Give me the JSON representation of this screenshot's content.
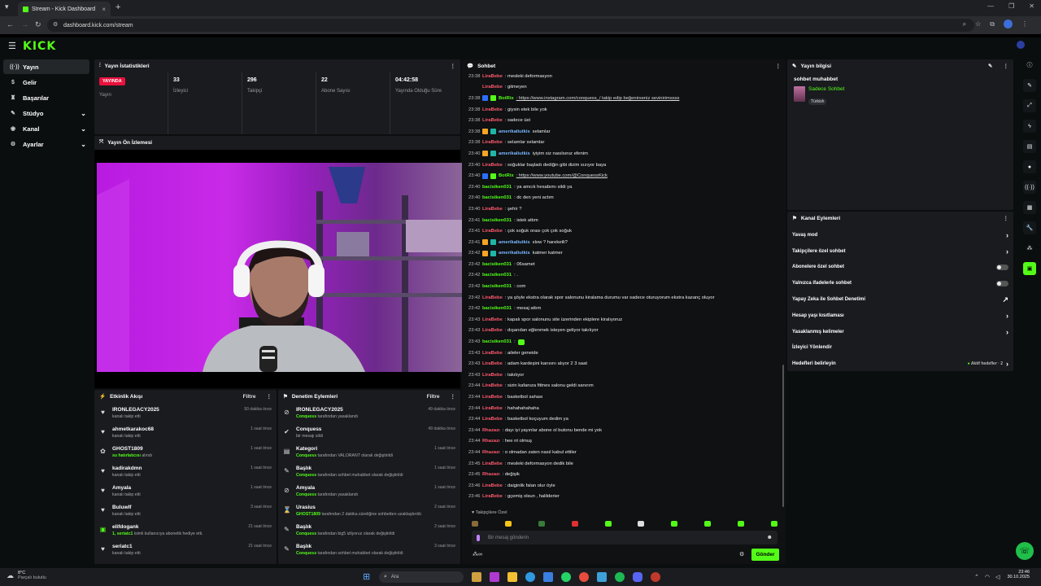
{
  "browser": {
    "tab_title": "Stream - Kick Dashboard",
    "url": "dashboard.kick.com/stream"
  },
  "logo": "KICK",
  "sidebar": {
    "items": [
      {
        "label": "Yayın",
        "icon": "broadcast-icon",
        "active": true
      },
      {
        "label": "Gelir",
        "icon": "money-icon"
      },
      {
        "label": "Başarılar",
        "icon": "trophy-icon"
      },
      {
        "label": "Stüdyo",
        "icon": "studio-icon",
        "expand": true
      },
      {
        "label": "Kanal",
        "icon": "channel-icon",
        "expand": true
      },
      {
        "label": "Ayarlar",
        "icon": "gear-icon",
        "expand": true
      }
    ]
  },
  "stats": {
    "title": "Yayın İstatistikleri",
    "live_badge": "YAYINDA",
    "live_label": "Yayın",
    "items": [
      {
        "value": "33",
        "label": "İzleyici"
      },
      {
        "value": "296",
        "label": "Takipçi"
      },
      {
        "value": "22",
        "label": "Abone Sayısı"
      },
      {
        "value": "04:42:58",
        "label": "Yayında Olduğu Süre"
      }
    ]
  },
  "preview": {
    "title": "Yayın Ön İzlemesi"
  },
  "activity": {
    "title": "Etkinlik Akışı",
    "filter": "Filtre",
    "rows": [
      {
        "icon": "heart-icon",
        "name": "IRONLEGACY2025",
        "desc": "kanalı takip etti",
        "time": "50 dakika önce"
      },
      {
        "icon": "heart-icon",
        "name": "ahmetkarakoc68",
        "desc": "kanalı takip etti",
        "time": "1 saat önce"
      },
      {
        "icon": "gift-icon",
        "name": "GHOST1809",
        "hl": "su hatırlatıcısı",
        "desc": "alındı",
        "time": "1 saat önce"
      },
      {
        "icon": "heart-icon",
        "name": "kadirakdmn",
        "desc": "kanalı takip etti",
        "time": "1 saat önce"
      },
      {
        "icon": "heart-icon",
        "name": "Amyala",
        "desc": "kanalı takip etti",
        "time": "1 saat önce"
      },
      {
        "icon": "heart-icon",
        "name": "Buluwlf",
        "desc": "kanalı takip etti",
        "time": "3 saat önce"
      },
      {
        "icon": "sub-gift-icon",
        "name": "elifdogank",
        "hl": "1, seriatc1",
        "desc": "isimli kullanıcıya abonelik hediye etti.",
        "time": "21 saat önce"
      },
      {
        "icon": "heart-icon",
        "name": "seriatc1",
        "desc": "kanalı takip etti",
        "time": "21 saat önce"
      }
    ]
  },
  "moderation": {
    "title": "Denetim Eylemleri",
    "filter": "Filtre",
    "rows": [
      {
        "icon": "ban-icon",
        "name": "IRONLEGACY2025",
        "hl": "Conquess",
        "desc": "tarafından yasaklandı",
        "time": "49 dakika önce"
      },
      {
        "icon": "check-icon",
        "name": "Conquess",
        "desc": "bir mesajı sildi",
        "time": "49 dakika önce"
      },
      {
        "icon": "category-icon",
        "name": "Kategori",
        "hl": "Conquess",
        "desc": "tarafından VALORANT olarak değiştirildi",
        "time": "1 saat önce"
      },
      {
        "icon": "title-icon",
        "name": "Başlık",
        "hl": "Conquess",
        "desc": "tarafından sohbet muhabbet olarak değiştirildi",
        "time": "1 saat önce"
      },
      {
        "icon": "ban-icon",
        "name": "Amyala",
        "hl": "Conquess",
        "desc": "tarafından yasaklandı",
        "time": "1 saat önce"
      },
      {
        "icon": "hourglass-icon",
        "name": "Urasius",
        "hl": "GHOST1809",
        "desc": "tarafından 2 dakika süreliğine sohbetten uzaklaştırıldı",
        "time": "2 saat önce"
      },
      {
        "icon": "title-icon",
        "name": "Başlık",
        "hl": "Conquess",
        "desc": "tarafından big5 izliyoruz olarak değiştirildi",
        "time": "2 saat önce"
      },
      {
        "icon": "title-icon",
        "name": "Başlık",
        "hl": "Conquess",
        "desc": "tarafından sohbet muhabbet olarak değiştirildi",
        "time": "3 saat önce"
      }
    ]
  },
  "chat": {
    "title": "Sohbet",
    "messages": [
      {
        "t": "23:38",
        "u": "LiraBebe",
        "c": "#ff5a6e",
        "m": ": mesleki deformasyon"
      },
      {
        "t": "",
        "u": "LiraBebe",
        "c": "#ff5a6e",
        "m": ": gitmeyen"
      },
      {
        "t": "23:38",
        "u": "BotRix",
        "c": "#53fc18",
        "m": ": https://www.instagram.com/conquess_/ takip edip beğenirseniz sevinirimssss",
        "badges": [
          "#2b6fff",
          "#53fc18"
        ],
        "link": true
      },
      {
        "t": "23:38",
        "u": "LiraBebe",
        "c": "#ff5a6e",
        "m": ": giysin etek bile yok"
      },
      {
        "t": "23:38",
        "u": "LiraBebe",
        "c": "#ff5a6e",
        "m": ": sadece üst"
      },
      {
        "t": "23:38",
        "u": "amerikaliutkis",
        "c": "#7ab6ff",
        "m": " selamlar",
        "badges": [
          "#f5a623",
          "#1fb6a5"
        ]
      },
      {
        "t": "23:38",
        "u": "LiraBebe",
        "c": "#ff5a6e",
        "m": ": selamlar selamlar"
      },
      {
        "t": "23:40",
        "u": "amerikaliutkis",
        "c": "#7ab6ff",
        "m": " iyiyim siz nasılsınız efenim",
        "badges": [
          "#f5a623",
          "#1fb6a5"
        ]
      },
      {
        "t": "23:40",
        "u": "LiraBebe",
        "c": "#ff5a6e",
        "m": ": soğuklar başladı dediğin gibi dizim sızıyor baya"
      },
      {
        "t": "23:40",
        "u": "BotRix",
        "c": "#53fc18",
        "m": ": https://www.youtube.com/@ConquessKick",
        "badges": [
          "#2b6fff",
          "#53fc18"
        ],
        "link": true
      },
      {
        "t": "23:40",
        "u": "bacisiken031",
        "c": "#53fc18",
        "m": ": ya amcık hesabımı sildi ya"
      },
      {
        "t": "23:40",
        "u": "bacisiken031",
        "c": "#53fc18",
        "m": ": dc den yeni actım"
      },
      {
        "t": "23:40",
        "u": "LiraBebe",
        "c": "#ff5a6e",
        "m": ": şehir ?"
      },
      {
        "t": "23:41",
        "u": "bacisiken031",
        "c": "#53fc18",
        "m": ": istek attım"
      },
      {
        "t": "23:41",
        "u": "LiraBebe",
        "c": "#ff5a6e",
        "m": ": çok soğuk orası çok çok soğuk"
      },
      {
        "t": "23:41",
        "u": "amerikaliutkis",
        "c": "#7ab6ff",
        "m": " slow ? hareketli?",
        "badges": [
          "#f5a623",
          "#1fb6a5"
        ]
      },
      {
        "t": "23:42",
        "u": "amerikaliutkis",
        "c": "#7ab6ff",
        "m": " katmer katmer",
        "badges": [
          "#f5a623",
          "#1fb6a5"
        ]
      },
      {
        "t": "23:42",
        "u": "bacisiken031",
        "c": "#53fc18",
        "m": ": 06samet"
      },
      {
        "t": "23:42",
        "u": "bacisiken031",
        "c": "#53fc18",
        "m": ": ."
      },
      {
        "t": "23:42",
        "u": "bacisiken031",
        "c": "#53fc18",
        "m": ": com"
      },
      {
        "t": "23:42",
        "u": "LiraBebe",
        "c": "#ff5a6e",
        "m": ": ya şöyle ekstra olarak spor salonunu kiralama durumu var sadece oturuyorum ekstra kazanç oluyor"
      },
      {
        "t": "23:42",
        "u": "bacisiken031",
        "c": "#53fc18",
        "m": ": mesaj attım"
      },
      {
        "t": "23:43",
        "u": "LiraBebe",
        "c": "#ff5a6e",
        "m": ": kapalı spor salonunu site üzerinden ekiplere kiralıyoruz"
      },
      {
        "t": "23:43",
        "u": "LiraBebe",
        "c": "#ff5a6e",
        "m": ": dışarıdan eğlenmek isteyen geliyor takılıyor"
      },
      {
        "t": "23:43",
        "u": "bacisiken031",
        "c": "#53fc18",
        "m": ":",
        "emote": true
      },
      {
        "t": "23:43",
        "u": "LiraBebe",
        "c": "#ff5a6e",
        "m": ": aileler geneide"
      },
      {
        "t": "23:43",
        "u": "LiraBebe",
        "c": "#ff5a6e",
        "m": ": adam kardeşini karısını alıyor 2 3 saat"
      },
      {
        "t": "23:43",
        "u": "LiraBebe",
        "c": "#ff5a6e",
        "m": ": takılıyor"
      },
      {
        "t": "23:44",
        "u": "LiraBebe",
        "c": "#ff5a6e",
        "m": ": sizin kafanıza fittnes salonu geldi sanırım"
      },
      {
        "t": "23:44",
        "u": "LiraBebe",
        "c": "#ff5a6e",
        "m": ": basketbol sahası"
      },
      {
        "t": "23:44",
        "u": "LiraBebe",
        "c": "#ff5a6e",
        "m": ": hahahahahaha"
      },
      {
        "t": "23:44",
        "u": "LiraBebe",
        "c": "#ff5a6e",
        "m": ": basketbol koçuyum dedim ya"
      },
      {
        "t": "23:44",
        "u": "Rhazazı",
        "c": "#ff5a6e",
        "m": ": dayı iyi yayınlar abone ol butonu bende mi yok"
      },
      {
        "t": "23:44",
        "u": "Rhazazı",
        "c": "#ff5a6e",
        "m": ": hee nt olmuş"
      },
      {
        "t": "23:44",
        "u": "Rhazazı",
        "c": "#ff5a6e",
        "m": ": o olmadan zaten nasıl kabul ettiler"
      },
      {
        "t": "23:45",
        "u": "LiraBebe",
        "c": "#ff5a6e",
        "m": ": mesleki deformasyon dedik bile"
      },
      {
        "t": "23:45",
        "u": "Rhazazı",
        "c": "#ff5a6e",
        "m": ": değişik"
      },
      {
        "t": "23:46",
        "u": "LiraBebe",
        "c": "#ff5a6e",
        "m": ": daiginlik falan olur öyle"
      },
      {
        "t": "23:46",
        "u": "LiraBebe",
        "c": "#ff5a6e",
        "m": ": gçemiş olsun , halilderier"
      }
    ],
    "followers_only": "Takipçilere Özel",
    "input_placeholder": "Bir mesaj gönderin",
    "send_label": "Gönder"
  },
  "stream_info": {
    "title": "Yayın bilgisi",
    "stream_title": "sohbet muhabbet",
    "category": "Sadece Sohbet",
    "language": "Türkish"
  },
  "channel_actions": {
    "title": "Kanal Eylemleri",
    "items": [
      {
        "label": "Yavaş mod",
        "ctrl": "chevron"
      },
      {
        "label": "Takipçilere özel sohbet",
        "ctrl": "chevron"
      },
      {
        "label": "Abonelere özel sohbet",
        "ctrl": "toggle"
      },
      {
        "label": "Yalnızca ifadelerle sohbet",
        "ctrl": "toggle"
      },
      {
        "label": "Yapay Zeka ile Sohbet Denetimi",
        "ctrl": "external"
      },
      {
        "label": "Hesap yaşı kısıtlaması",
        "ctrl": "chevron"
      },
      {
        "label": "Yasaklanmış kelimeler",
        "ctrl": "chevron"
      },
      {
        "label": "İzleyici Yönlendir",
        "ctrl": "none"
      },
      {
        "label": "Hedefleri belirleyin",
        "ctrl": "goals",
        "note": "Aktif hedefler · 2"
      }
    ]
  },
  "taskbar": {
    "weather_temp": "8°C",
    "weather_desc": "Parçalı bulutlu",
    "search": "Ara",
    "time": "23:46",
    "date": "30.10.2025"
  },
  "colors": {
    "accent": "#53fc18",
    "live": "#e8123c"
  }
}
